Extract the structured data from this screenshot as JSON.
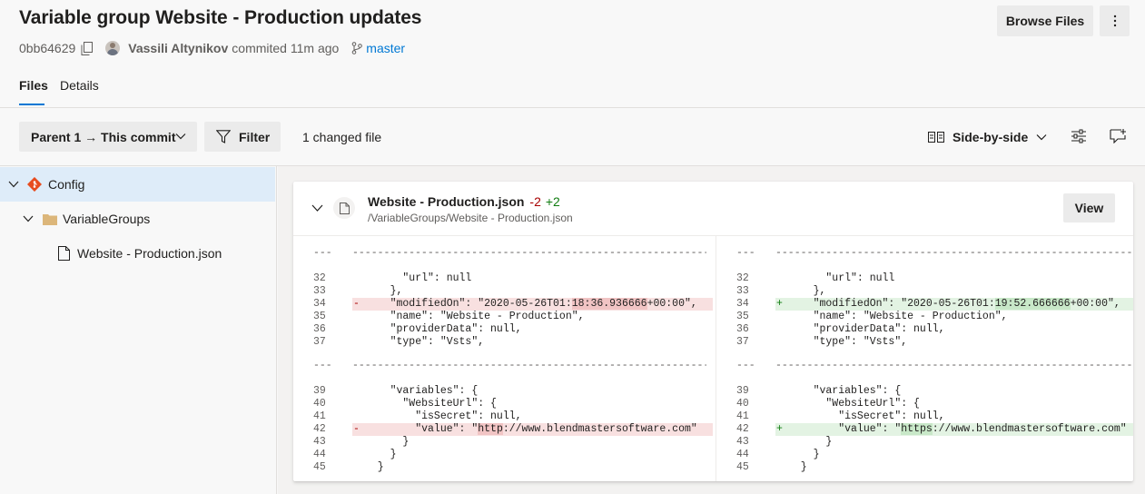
{
  "header": {
    "title": "Variable group Website - Production updates",
    "commit_hash": "0bb64629",
    "author": "Vassili Altynikov",
    "action": "commited 11m ago",
    "branch": "master",
    "browse_files_label": "Browse Files"
  },
  "tabs": [
    {
      "label": "Files",
      "active": true
    },
    {
      "label": "Details",
      "active": false
    }
  ],
  "toolbar": {
    "parent_label": "Parent 1 → This commit",
    "filter_label": "Filter",
    "changed_files": "1 changed file",
    "view_mode_label": "Side-by-side"
  },
  "tree": [
    {
      "label": "Config",
      "type": "repo",
      "selected": true
    },
    {
      "label": "VariableGroups",
      "type": "folder"
    },
    {
      "label": "Website - Production.json",
      "type": "file"
    }
  ],
  "file": {
    "name": "Website - Production.json",
    "deletions": "-2",
    "additions": "+2",
    "path": "/VariableGroups/Website - Production.json",
    "view_label": "View"
  },
  "diff": {
    "separator": "---",
    "left": {
      "hunk1": [
        {
          "num": "32",
          "code": "      \"url\": null"
        },
        {
          "num": "33",
          "code": "    },"
        },
        {
          "num": "34",
          "code": "    \"modifiedOn\": \"2020-05-26T01:18:36.936666+00:00\",",
          "mark": "-",
          "hl": "18:36.936666"
        },
        {
          "num": "35",
          "code": "    \"name\": \"Website - Production\","
        },
        {
          "num": "36",
          "code": "    \"providerData\": null,"
        },
        {
          "num": "37",
          "code": "    \"type\": \"Vsts\","
        }
      ],
      "hunk2": [
        {
          "num": "39",
          "code": "    \"variables\": {"
        },
        {
          "num": "40",
          "code": "      \"WebsiteUrl\": {"
        },
        {
          "num": "41",
          "code": "        \"isSecret\": null,"
        },
        {
          "num": "42",
          "code": "        \"value\": \"http://www.blendmastersoftware.com\"",
          "mark": "-",
          "hl": "http"
        },
        {
          "num": "43",
          "code": "      }"
        },
        {
          "num": "44",
          "code": "    }"
        },
        {
          "num": "45",
          "code": "  }"
        }
      ]
    },
    "right": {
      "hunk1": [
        {
          "num": "32",
          "code": "      \"url\": null"
        },
        {
          "num": "33",
          "code": "    },"
        },
        {
          "num": "34",
          "code": "    \"modifiedOn\": \"2020-05-26T01:19:52.666666+00:00\",",
          "mark": "+",
          "hl": "19:52.666666"
        },
        {
          "num": "35",
          "code": "    \"name\": \"Website - Production\","
        },
        {
          "num": "36",
          "code": "    \"providerData\": null,"
        },
        {
          "num": "37",
          "code": "    \"type\": \"Vsts\","
        }
      ],
      "hunk2": [
        {
          "num": "39",
          "code": "    \"variables\": {"
        },
        {
          "num": "40",
          "code": "      \"WebsiteUrl\": {"
        },
        {
          "num": "41",
          "code": "        \"isSecret\": null,"
        },
        {
          "num": "42",
          "code": "        \"value\": \"https://www.blendmastersoftware.com\"",
          "mark": "+",
          "hl": "https"
        },
        {
          "num": "43",
          "code": "      }"
        },
        {
          "num": "44",
          "code": "    }"
        },
        {
          "num": "45",
          "code": "  }"
        }
      ]
    }
  },
  "colors": {
    "accent": "#0078d4",
    "deletion": "#a80000",
    "addition": "#107c10",
    "selected_row": "#deecf9"
  },
  "icons": {
    "copy": "copy-icon",
    "branch": "branch-icon",
    "more": "more-vertical-icon",
    "filter": "filter-icon",
    "side_by_side": "side-by-side-icon",
    "settings": "sliders-icon",
    "comment": "comment-add-icon",
    "repo": "git-repo-icon",
    "folder": "folder-icon",
    "file": "file-icon"
  }
}
